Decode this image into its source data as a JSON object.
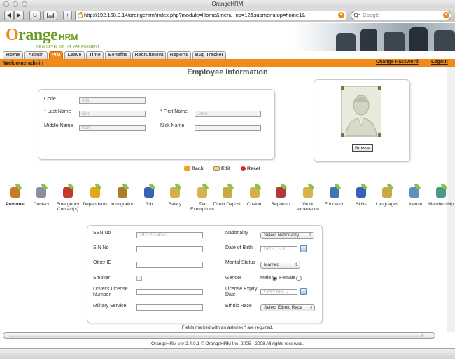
{
  "browser": {
    "window_title": "OrangeHRM",
    "back_glyph": "◀",
    "forward_glyph": "▶",
    "reload_glyph": "C",
    "add_glyph": "+",
    "url": "http://192.168.0.14/orangehrm/index.php?module=Home&menu_no=12&submenutop=home1&",
    "search_placeholder": "Google"
  },
  "header": {
    "logo_prefix": "O",
    "logo_word": "range",
    "logo_hrm": "HRM",
    "tagline": "NEW LEVEL OF HR MANAGEMENT"
  },
  "tabs": [
    {
      "label": "Home"
    },
    {
      "label": "Admin"
    },
    {
      "label": "PIM"
    },
    {
      "label": "Leave"
    },
    {
      "label": "Time"
    },
    {
      "label": "Benefits"
    },
    {
      "label": "Recruitment"
    },
    {
      "label": "Reports"
    },
    {
      "label": "Bug Tracker"
    }
  ],
  "userbar": {
    "welcome": "Welcome admin",
    "change_password": "Change Password",
    "logout": "Logout"
  },
  "page_title": "Employee Information",
  "employee": {
    "code_label": "Code",
    "code_value": "001",
    "last_name_label": "Last Name",
    "last_name_value": "Doe",
    "first_name_label": "First Name",
    "first_name_value": "John",
    "middle_name_label": "Middle Name",
    "middle_name_value": "Karl",
    "nick_name_label": "Nick Name",
    "nick_name_value": "",
    "required_marker": "*"
  },
  "photo": {
    "browse_label": "Browse"
  },
  "actions": {
    "back": "Back",
    "edit": "Edit",
    "reset": "Reset"
  },
  "sections": [
    {
      "label": "Personal",
      "icon": "personal-icon",
      "color": "#c77a28"
    },
    {
      "label": "Contact",
      "icon": "contact-icon",
      "color": "#8a8fa0"
    },
    {
      "label": "Emergency Contact(s)",
      "icon": "emergency-icon",
      "color": "#c23a2e"
    },
    {
      "label": "Dependents",
      "icon": "dependents-icon",
      "color": "#e0a81c"
    },
    {
      "label": "Immigration",
      "icon": "immigration-icon",
      "color": "#b07a2c"
    },
    {
      "label": "Job",
      "icon": "job-icon",
      "color": "#3a62b0"
    },
    {
      "label": "Salary",
      "icon": "salary-icon",
      "color": "#d0b04a"
    },
    {
      "label": "Tax Exemptions",
      "icon": "tax-icon",
      "color": "#d7b24e"
    },
    {
      "label": "Direct Deposit",
      "icon": "deposit-icon",
      "color": "#c9a845"
    },
    {
      "label": "Custom",
      "icon": "custom-icon",
      "color": "#d2b04c"
    },
    {
      "label": "Report-to",
      "icon": "report-to-icon",
      "color": "#b03a3a"
    },
    {
      "label": "Work experience",
      "icon": "work-experience-icon",
      "color": "#d6b24a"
    },
    {
      "label": "Education",
      "icon": "education-icon",
      "color": "#3a7ab0"
    },
    {
      "label": "Skills",
      "icon": "skills-icon",
      "color": "#3a5fb8"
    },
    {
      "label": "Languages",
      "icon": "languages-icon",
      "color": "#c9a845"
    },
    {
      "label": "License",
      "icon": "license-icon",
      "color": "#5d8fbf"
    },
    {
      "label": "Membership",
      "icon": "membership-icon",
      "color": "#4a9a8a"
    }
  ],
  "personal": {
    "ssn_label": "SSN No :",
    "ssn_value": "292-393-4343",
    "sin_label": "SIN No :",
    "other_id_label": "Other ID",
    "smoker_label": "Smoker",
    "driver_license_label": "Driver's License Number",
    "military_label": "Military Service",
    "nationality_label": "Nationality",
    "nationality_value": "Select Nationality",
    "dob_label": "Date of Birth",
    "dob_value": "1972-12-30",
    "marital_label": "Marital Status",
    "marital_value": "Married",
    "gender_label": "Gender",
    "gender_male": "Male",
    "gender_female": "Female",
    "license_expiry_label": "License Expiry Date",
    "license_expiry_placeholder": "YYYY-mm-D",
    "ethnic_label": "Ethnic Race",
    "ethnic_value": "Select Ethnic Race"
  },
  "footer": {
    "required_note": "Fields marked with an asterisk * are required.",
    "copyright_link": "OrangeHRM",
    "copyright_rest": " ver 2.4.0.1 © OrangeHRM Inc. 2005 - 2008 All rights reserved."
  }
}
